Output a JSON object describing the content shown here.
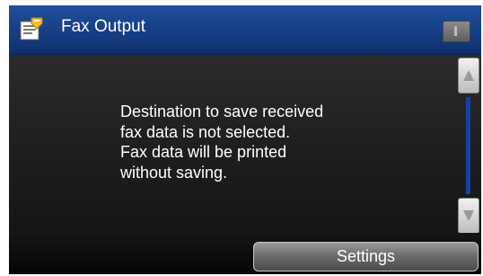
{
  "header": {
    "title": "Fax Output",
    "title_icon": "fax-output-icon",
    "status_icon": "status-indicator-icon"
  },
  "message": {
    "lines": [
      "Destination to save received",
      "fax data is not selected.",
      "Fax data will be printed",
      "without saving."
    ]
  },
  "scroll": {
    "up_icon": "scroll-up-icon",
    "down_icon": "scroll-down-icon"
  },
  "footer": {
    "settings_label": "Settings"
  },
  "colors": {
    "title_bar": "#173e85",
    "scroll_track": "#1a3ea8",
    "screen_bg": "#000000"
  }
}
